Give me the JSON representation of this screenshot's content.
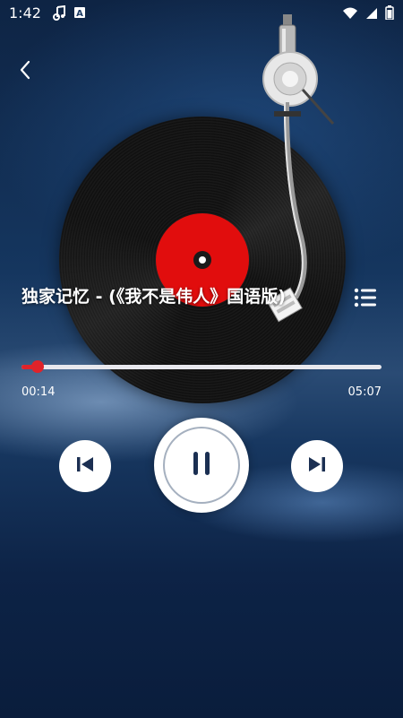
{
  "status_bar": {
    "time": "1:42",
    "icons_left": [
      "music-note-icon",
      "a-badge-icon"
    ],
    "icons_right": [
      "wifi-icon",
      "signal-icon",
      "battery-icon"
    ]
  },
  "nav": {
    "back_icon": "chevron-left-icon"
  },
  "player": {
    "song_title": "独家记忆 - (《我不是伟人》国语版)",
    "current_time": "00:14",
    "total_time": "05:07",
    "progress": 0.0456,
    "vinyl_label_color": "#e10d0d",
    "accent_color": "#e0232a"
  },
  "controls": {
    "prev_icon": "skip-previous-icon",
    "play_pause_icon": "pause-icon",
    "next_icon": "skip-next-icon",
    "playlist_icon": "list-icon"
  }
}
